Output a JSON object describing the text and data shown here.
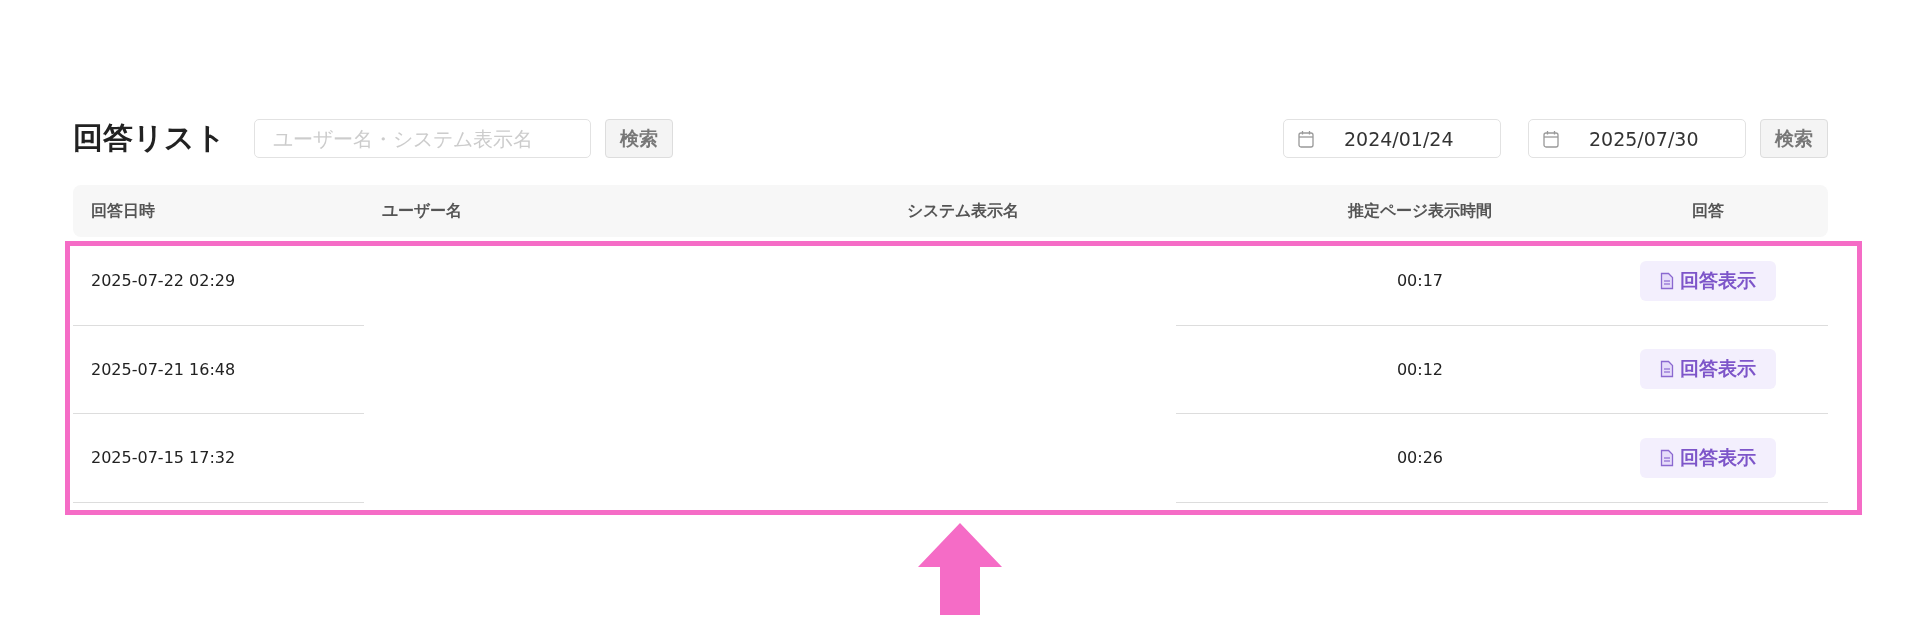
{
  "title": "回答リスト",
  "search": {
    "placeholder": "ユーザー名・システム表示名",
    "button": "検索"
  },
  "date_range": {
    "start": "2024/01/24",
    "end": "2025/07/30",
    "button": "検索"
  },
  "table": {
    "columns": [
      "回答日時",
      "ユーザー名",
      "システム表示名",
      "推定ページ表示時間",
      "回答"
    ],
    "rows": [
      {
        "answered_at": "2025-07-22 02:29",
        "view_time": "00:17",
        "action": "回答表示"
      },
      {
        "answered_at": "2025-07-21 16:48",
        "view_time": "00:12",
        "action": "回答表示"
      },
      {
        "answered_at": "2025-07-15 17:32",
        "view_time": "00:26",
        "action": "回答表示"
      }
    ]
  }
}
